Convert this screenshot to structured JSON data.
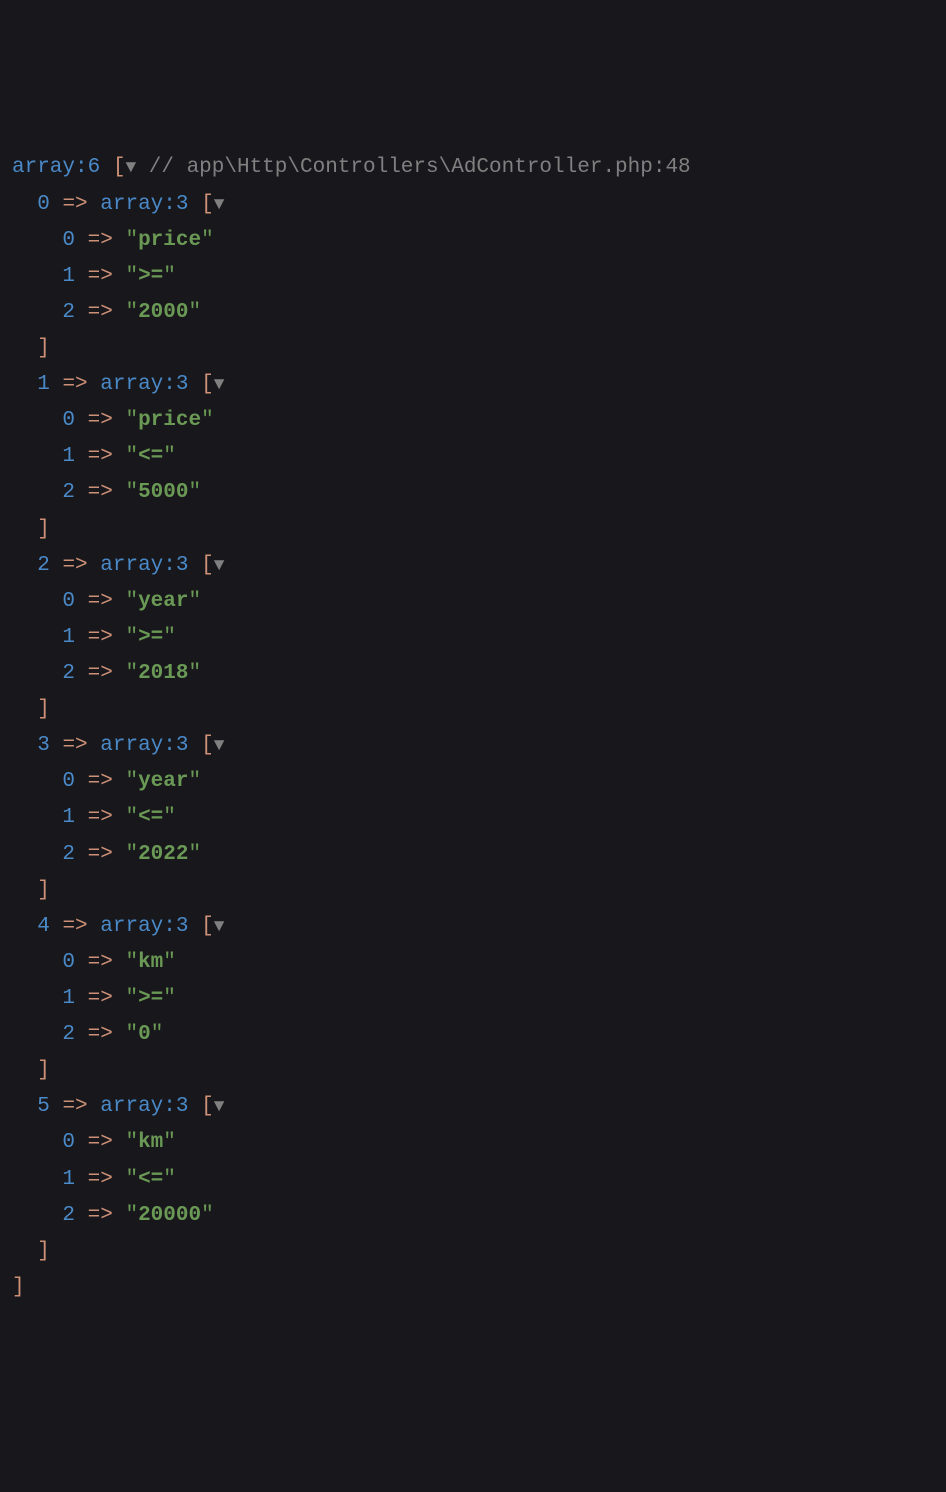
{
  "top": {
    "array_label": "array:6",
    "comment": "// app\\Http\\Controllers\\AdController.php:48"
  },
  "inner_array_label": "array:3",
  "caret": "▼",
  "arrow": "=>",
  "items": [
    {
      "index": "0",
      "vals": [
        "price",
        ">=",
        "2000"
      ]
    },
    {
      "index": "1",
      "vals": [
        "price",
        "<=",
        "5000"
      ]
    },
    {
      "index": "2",
      "vals": [
        "year",
        ">=",
        "2018"
      ]
    },
    {
      "index": "3",
      "vals": [
        "year",
        "<=",
        "2022"
      ]
    },
    {
      "index": "4",
      "vals": [
        "km",
        ">=",
        "0"
      ]
    },
    {
      "index": "5",
      "vals": [
        "km",
        "<=",
        "20000"
      ]
    }
  ]
}
